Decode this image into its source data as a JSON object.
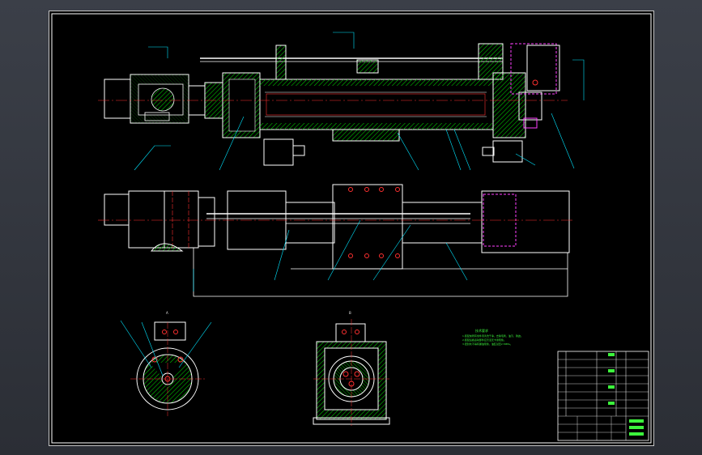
{
  "app": {
    "title": ""
  },
  "colors": {
    "background": "#000000",
    "frame": "#ffffff",
    "outline": "#ffffff",
    "hatch": "#00c800",
    "centerline": "#ff3030",
    "leader": "#00e5ff",
    "hidden": "#ff40ff",
    "text_green": "#3cf43c"
  },
  "annotations": {
    "view_label_a": "A",
    "view_label_b": "B",
    "tech_requirements_title": "技术要求",
    "tech_requirements": [
      "1.装配前所有零件须清洗干净，去除毛刺、油污、锈迹。",
      "2.装配后各运动部件应灵活无卡滞现象。",
      "3.密封处不得有漏油现象，油缸试压2.5MPa。"
    ]
  },
  "title_block": {
    "drawing_title": "",
    "company": "",
    "rows": [
      "",
      "",
      "",
      "",
      "",
      "",
      "",
      ""
    ],
    "scale": "",
    "sheet": ""
  }
}
